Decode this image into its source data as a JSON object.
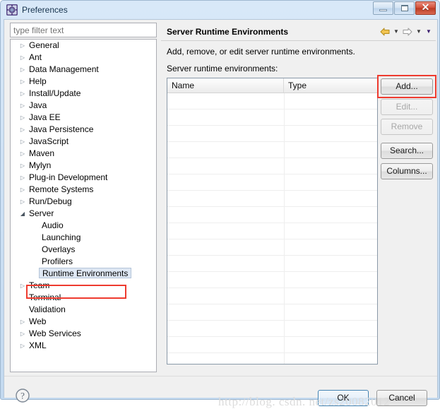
{
  "window": {
    "title": "Preferences",
    "icon": "preferences-icon",
    "minimize_label": "Minimize",
    "maximize_label": "Maximize",
    "close_label": "✕"
  },
  "filter": {
    "value": "",
    "placeholder": "type filter text"
  },
  "tree": {
    "items": [
      {
        "label": "General",
        "expandable": true,
        "expanded": false,
        "child": false,
        "selected": false
      },
      {
        "label": "Ant",
        "expandable": true,
        "expanded": false,
        "child": false,
        "selected": false
      },
      {
        "label": "Data Management",
        "expandable": true,
        "expanded": false,
        "child": false,
        "selected": false
      },
      {
        "label": "Help",
        "expandable": true,
        "expanded": false,
        "child": false,
        "selected": false
      },
      {
        "label": "Install/Update",
        "expandable": true,
        "expanded": false,
        "child": false,
        "selected": false
      },
      {
        "label": "Java",
        "expandable": true,
        "expanded": false,
        "child": false,
        "selected": false
      },
      {
        "label": "Java EE",
        "expandable": true,
        "expanded": false,
        "child": false,
        "selected": false
      },
      {
        "label": "Java Persistence",
        "expandable": true,
        "expanded": false,
        "child": false,
        "selected": false
      },
      {
        "label": "JavaScript",
        "expandable": true,
        "expanded": false,
        "child": false,
        "selected": false
      },
      {
        "label": "Maven",
        "expandable": true,
        "expanded": false,
        "child": false,
        "selected": false
      },
      {
        "label": "Mylyn",
        "expandable": true,
        "expanded": false,
        "child": false,
        "selected": false
      },
      {
        "label": "Plug-in Development",
        "expandable": true,
        "expanded": false,
        "child": false,
        "selected": false
      },
      {
        "label": "Remote Systems",
        "expandable": true,
        "expanded": false,
        "child": false,
        "selected": false
      },
      {
        "label": "Run/Debug",
        "expandable": true,
        "expanded": false,
        "child": false,
        "selected": false
      },
      {
        "label": "Server",
        "expandable": true,
        "expanded": true,
        "child": false,
        "selected": false
      },
      {
        "label": "Audio",
        "expandable": false,
        "expanded": false,
        "child": true,
        "selected": false
      },
      {
        "label": "Launching",
        "expandable": false,
        "expanded": false,
        "child": true,
        "selected": false
      },
      {
        "label": "Overlays",
        "expandable": false,
        "expanded": false,
        "child": true,
        "selected": false
      },
      {
        "label": "Profilers",
        "expandable": false,
        "expanded": false,
        "child": true,
        "selected": false
      },
      {
        "label": "Runtime Environments",
        "expandable": false,
        "expanded": false,
        "child": true,
        "selected": true
      },
      {
        "label": "Team",
        "expandable": true,
        "expanded": false,
        "child": false,
        "selected": false
      },
      {
        "label": "Terminal",
        "expandable": false,
        "expanded": false,
        "child": false,
        "selected": false
      },
      {
        "label": "Validation",
        "expandable": false,
        "expanded": false,
        "child": false,
        "selected": false
      },
      {
        "label": "Web",
        "expandable": true,
        "expanded": false,
        "child": false,
        "selected": false
      },
      {
        "label": "Web Services",
        "expandable": true,
        "expanded": false,
        "child": false,
        "selected": false
      },
      {
        "label": "XML",
        "expandable": true,
        "expanded": false,
        "child": false,
        "selected": false
      }
    ],
    "collapsed_arrow": "▷",
    "expanded_arrow": "◢"
  },
  "panel": {
    "title": "Server Runtime Environments",
    "description": "Add, remove, or edit server runtime environments.",
    "list_label": "Server runtime environments:",
    "nav": {
      "back_icon": "back-arrow-icon",
      "back_caret": "▼",
      "forward_icon": "forward-arrow-icon",
      "forward_caret": "▼",
      "menu_caret": "▼"
    }
  },
  "table": {
    "columns": [
      "Name",
      "Type"
    ],
    "rows": [],
    "empty_row_count": 17
  },
  "side_buttons": [
    {
      "label": "Add...",
      "enabled": true,
      "highlighted": true
    },
    {
      "label": "Edit...",
      "enabled": false,
      "highlighted": false
    },
    {
      "label": "Remove",
      "enabled": false,
      "highlighted": false
    },
    {
      "label": "Search...",
      "enabled": true,
      "highlighted": false
    },
    {
      "label": "Columns...",
      "enabled": true,
      "highlighted": false
    }
  ],
  "footer": {
    "help_icon": "help-question-icon",
    "ok_label": "OK",
    "cancel_label": "Cancel"
  },
  "watermark": "http://blog. csdn. net/zs20082012",
  "colors": {
    "annotation": "#ee3b2f",
    "selection_bg": "#dfe8f4",
    "title_text": "#16334d",
    "close_button": "#bb3a23"
  }
}
